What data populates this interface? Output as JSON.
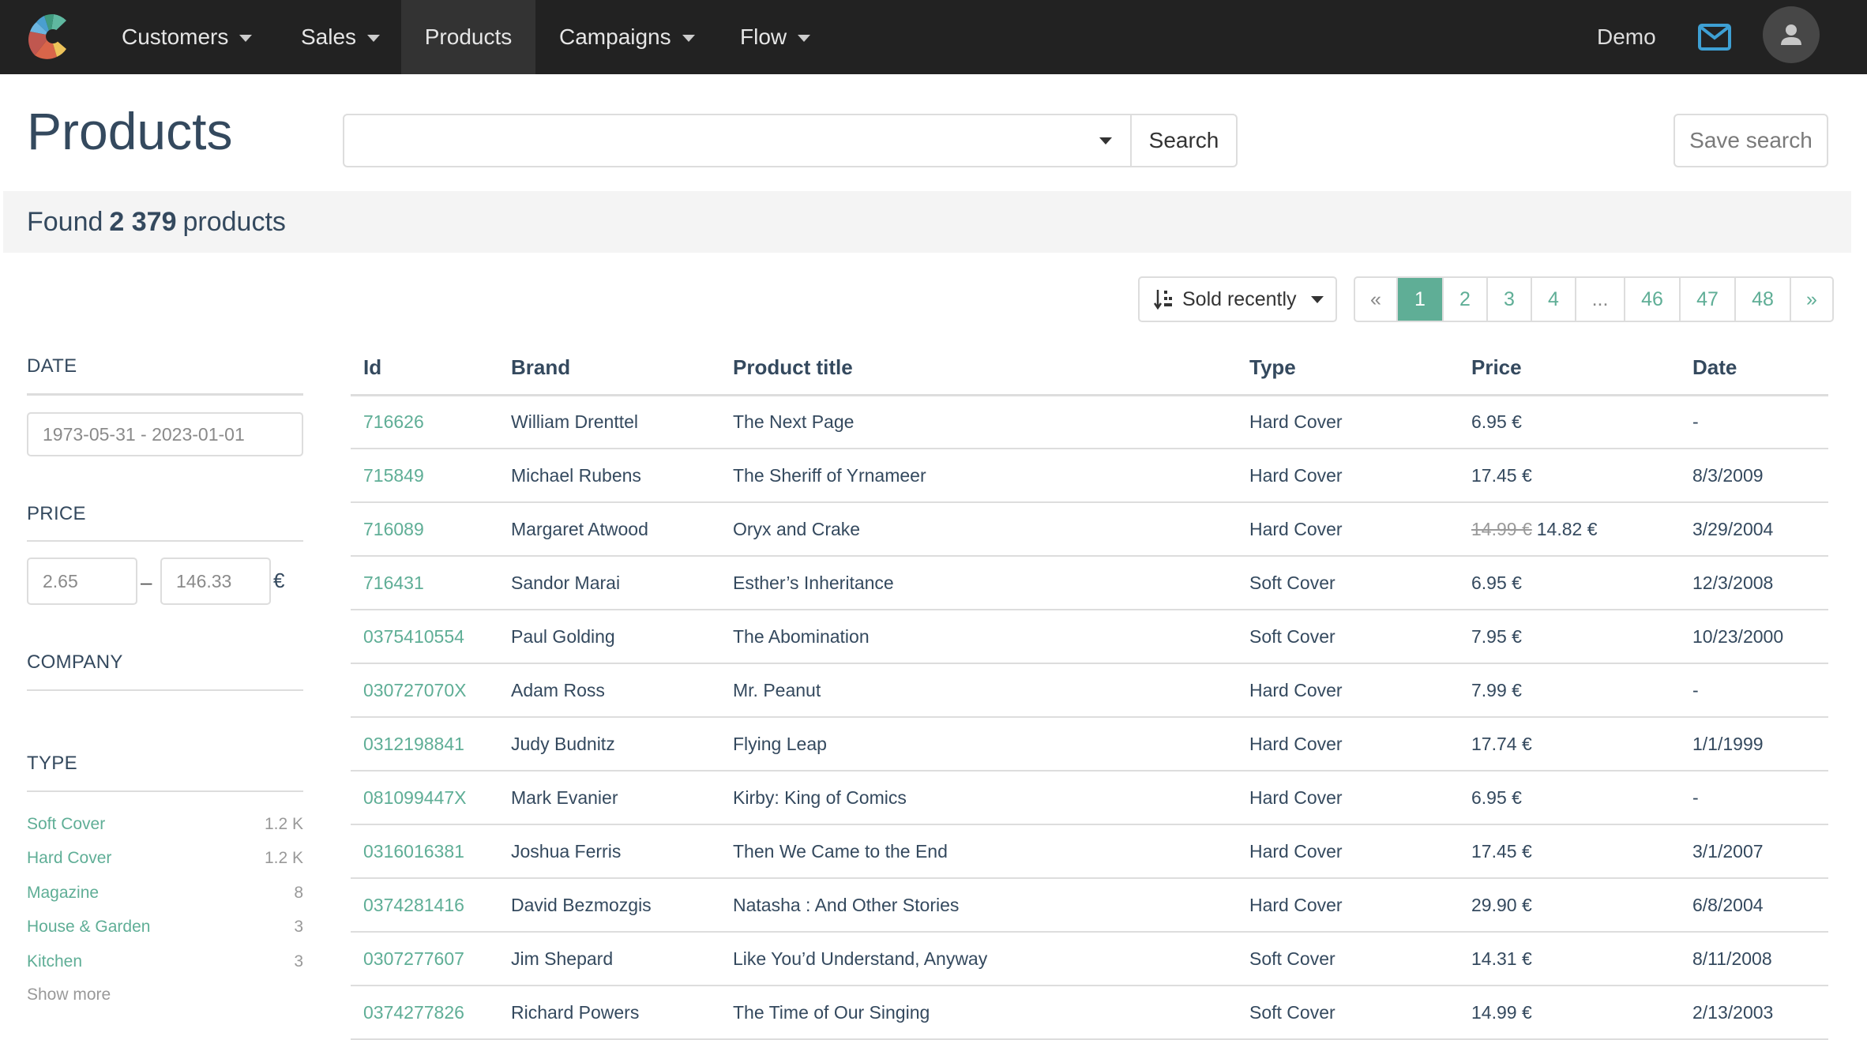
{
  "nav": {
    "items": [
      {
        "label": "Customers",
        "has_dropdown": true,
        "active": false
      },
      {
        "label": "Sales",
        "has_dropdown": true,
        "active": false
      },
      {
        "label": "Products",
        "has_dropdown": false,
        "active": true
      },
      {
        "label": "Campaigns",
        "has_dropdown": true,
        "active": false
      },
      {
        "label": "Flow",
        "has_dropdown": true,
        "active": false
      }
    ],
    "user_label": "Demo",
    "mail_icon": "envelope-icon",
    "avatar_icon": "user-icon",
    "mail_color": "#3ea0d4"
  },
  "page": {
    "title": "Products",
    "search_value": "",
    "search_button": "Search",
    "save_search_button": "Save search"
  },
  "results": {
    "prefix": "Found",
    "count": "2 379",
    "suffix": "products"
  },
  "sort": {
    "icon": "sort-descending-icon",
    "selected": "Sold recently"
  },
  "pagination": {
    "prev": "«",
    "pages": [
      "1",
      "2",
      "3",
      "4",
      "...",
      "46",
      "47",
      "48"
    ],
    "current": "1",
    "next": "»"
  },
  "filters": {
    "date": {
      "title": "DATE",
      "value": "1973-05-31 - 2023-01-01"
    },
    "price": {
      "title": "PRICE",
      "min": "2.65",
      "separator": "–",
      "max": "146.33",
      "currency": "€"
    },
    "company": {
      "title": "COMPANY"
    },
    "type": {
      "title": "TYPE",
      "items": [
        {
          "label": "Soft Cover",
          "count": "1.2 K"
        },
        {
          "label": "Hard Cover",
          "count": "1.2 K"
        },
        {
          "label": "Magazine",
          "count": "8"
        },
        {
          "label": "House & Garden",
          "count": "3"
        },
        {
          "label": "Kitchen",
          "count": "3"
        }
      ],
      "show_more": "Show more"
    }
  },
  "table": {
    "columns": [
      "Id",
      "Brand",
      "Product title",
      "Type",
      "Price",
      "Date"
    ],
    "rows": [
      {
        "id": "716626",
        "brand": "William Drenttel",
        "title": "The Next Page",
        "type": "Hard Cover",
        "old_price": "",
        "price": "6.95 €",
        "date": "-"
      },
      {
        "id": "715849",
        "brand": "Michael Rubens",
        "title": "The Sheriff of Yrnameer",
        "type": "Hard Cover",
        "old_price": "",
        "price": "17.45 €",
        "date": "8/3/2009"
      },
      {
        "id": "716089",
        "brand": "Margaret Atwood",
        "title": "Oryx and Crake",
        "type": "Hard Cover",
        "old_price": "14.99 €",
        "price": "14.82 €",
        "date": "3/29/2004"
      },
      {
        "id": "716431",
        "brand": "Sandor Marai",
        "title": "Esther’s Inheritance",
        "type": "Soft Cover",
        "old_price": "",
        "price": "6.95 €",
        "date": "12/3/2008"
      },
      {
        "id": "0375410554",
        "brand": "Paul Golding",
        "title": "The Abomination",
        "type": "Soft Cover",
        "old_price": "",
        "price": "7.95 €",
        "date": "10/23/2000"
      },
      {
        "id": "030727070X",
        "brand": "Adam Ross",
        "title": "Mr. Peanut",
        "type": "Hard Cover",
        "old_price": "",
        "price": "7.99 €",
        "date": "-"
      },
      {
        "id": "0312198841",
        "brand": "Judy Budnitz",
        "title": "Flying Leap",
        "type": "Hard Cover",
        "old_price": "",
        "price": "17.74 €",
        "date": "1/1/1999"
      },
      {
        "id": "081099447X",
        "brand": "Mark Evanier",
        "title": "Kirby: King of Comics",
        "type": "Hard Cover",
        "old_price": "",
        "price": "6.95 €",
        "date": "-"
      },
      {
        "id": "0316016381",
        "brand": "Joshua Ferris",
        "title": "Then We Came to the End",
        "type": "Hard Cover",
        "old_price": "",
        "price": "17.45 €",
        "date": "3/1/2007"
      },
      {
        "id": "0374281416",
        "brand": "David Bezmozgis",
        "title": "Natasha : And Other Stories",
        "type": "Hard Cover",
        "old_price": "",
        "price": "29.90 €",
        "date": "6/8/2004"
      },
      {
        "id": "0307277607",
        "brand": "Jim Shepard",
        "title": "Like You’d Understand, Anyway",
        "type": "Soft Cover",
        "old_price": "",
        "price": "14.31 €",
        "date": "8/11/2008"
      },
      {
        "id": "0374277826",
        "brand": "Richard Powers",
        "title": "The Time of Our Singing",
        "type": "Soft Cover",
        "old_price": "",
        "price": "14.99 €",
        "date": "2/13/2003"
      }
    ]
  },
  "colors": {
    "accent": "#5fae96",
    "nav_bg": "#222222",
    "text": "#34495e"
  }
}
